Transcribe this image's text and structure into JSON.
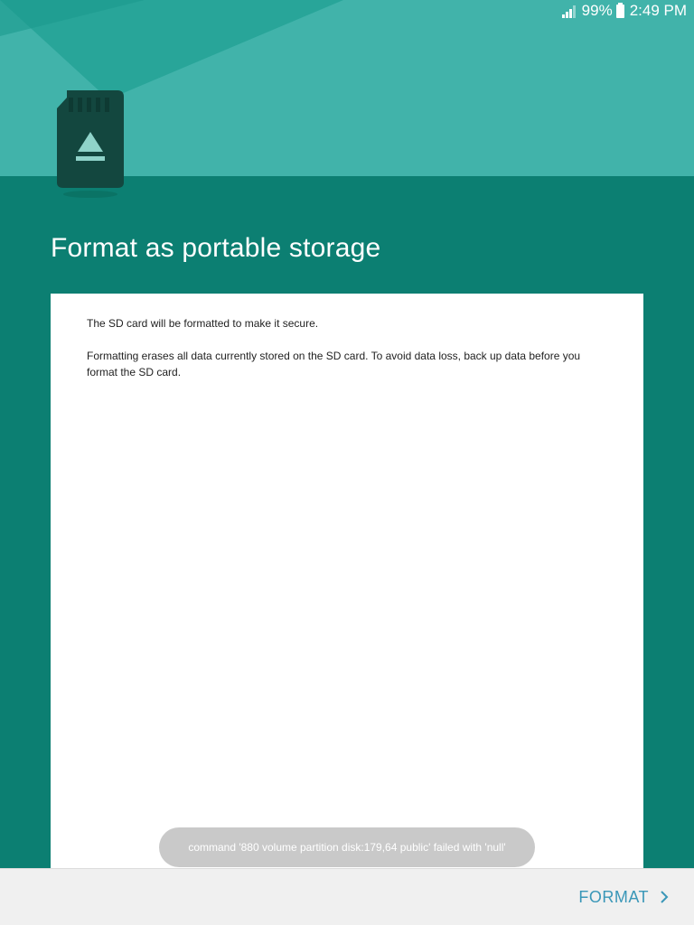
{
  "status_bar": {
    "battery_percent": "99%",
    "time": "2:49 PM",
    "signal_level": 0.6
  },
  "title": "Format as portable storage",
  "body": {
    "paragraph_1": "The SD card will be formatted to make it secure.",
    "paragraph_2": "Formatting erases all data currently stored on the SD card. To avoid data loss, back up data before you format the SD card."
  },
  "toast": "command '880 volume partition disk:179,64 public' failed with 'null'",
  "footer": {
    "format_label": "FORMAT"
  },
  "colors": {
    "header": "#41b3aa",
    "background": "#0c7f72",
    "button_text": "#3a97b8",
    "sd_card": "#13473f"
  }
}
